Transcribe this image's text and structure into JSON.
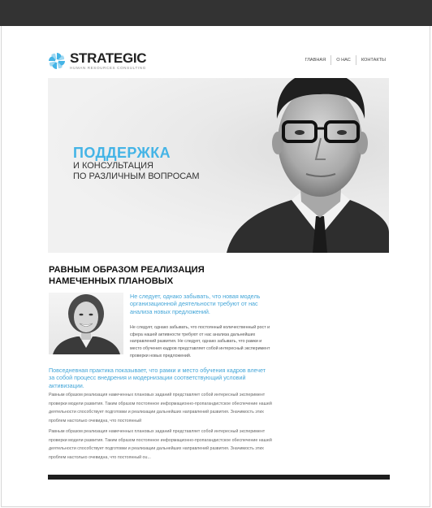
{
  "brand": {
    "name": "STRATEGIC",
    "tagline": "HUMAN RESOURCES CONSULTING",
    "accent": "#44b4e6"
  },
  "nav": {
    "items": [
      {
        "label": "ГЛАВНАЯ"
      },
      {
        "label": "О НАС"
      },
      {
        "label": "КОНТАКТЫ"
      }
    ]
  },
  "hero": {
    "title": "ПОДДЕРЖКА",
    "line2": "И КОНСУЛЬТАЦИЯ",
    "line3": "ПО РАЗЛИЧНЫМ ВОПРОСАМ"
  },
  "content": {
    "headline": "РАВНЫМ ОБРАЗОМ РЕАЛИЗАЦИЯ НАМЕЧЕННЫХ ПЛАНОВЫХ",
    "lead1": "Не следует, однако забывать, что новая модель организационной деятельности требуют от нас анализа новых предложений.",
    "para1": "Не следует, однако забывать, что постоянный количественный рост и сфера нашей активности требуют от нас анализа дальнейших направлений развития. Не следует, однако забывать, что рамки и место обучения кадров представляет собой интересный эксперимент проверки новых предложений.",
    "lead2": "Повседневная практика показывает, что рамки и место обучения кадров влечет за собой процесс внедрения и модернизации соответствующий условий активизации.",
    "para2": "Равным образом реализация намеченных плановых заданий представляет собой интересный эксперимент проверки модели развития. Таким образом постоянное информационно-пропагандистское обеспечение нашей деятельности способствует подготовки и реализации дальнейших направлений развития. Значимость этих проблем настолько очевидна, что постоянный",
    "para3": "Равным образом реализация намеченных плановых заданий представляет собой интересный эксперимент проверки модели развития. Таким образом постоянное информационно-пропагандистское обеспечение нашей деятельности способствует подготовки и реализации дальнейших направлений развития. Значимость этих проблем настолько очевидна, что постоянный ou..."
  }
}
